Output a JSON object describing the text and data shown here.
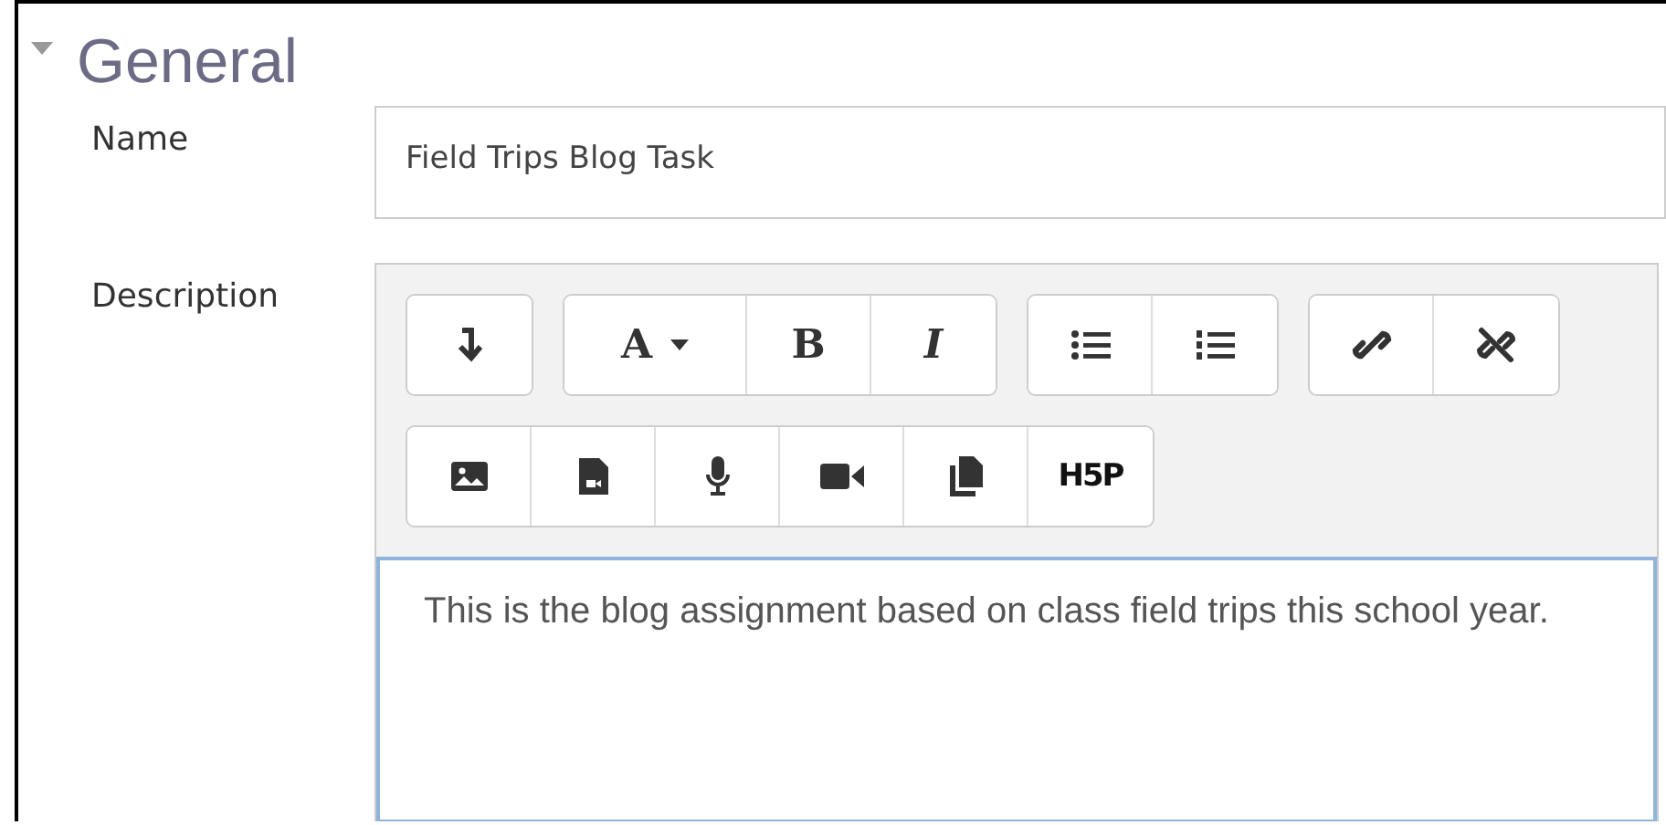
{
  "section": {
    "title": "General",
    "expanded": true
  },
  "name_field": {
    "label": "Name",
    "value": "Field Trips Blog Task"
  },
  "description": {
    "label": "Description",
    "toolbar_rows": [
      [
        [
          {
            "kind": "arrow"
          }
        ],
        [
          {
            "kind": "font",
            "label": "A"
          },
          {
            "kind": "bold",
            "label": "B"
          },
          {
            "kind": "italic",
            "label": "I"
          }
        ],
        [
          {
            "kind": "bullets"
          },
          {
            "kind": "numbers"
          }
        ],
        [
          {
            "kind": "link"
          },
          {
            "kind": "unlink"
          }
        ]
      ],
      [
        [
          {
            "kind": "image"
          },
          {
            "kind": "videofile"
          },
          {
            "kind": "mic"
          },
          {
            "kind": "camera"
          },
          {
            "kind": "copy"
          },
          {
            "kind": "logo",
            "label": "H5P"
          }
        ]
      ]
    ],
    "text": "This is the blog assignment based on class field trips this school year."
  }
}
